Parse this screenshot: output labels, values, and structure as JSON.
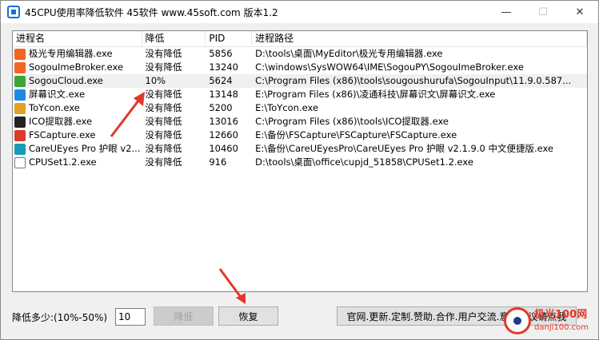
{
  "window": {
    "title": "45CPU使用率降低软件 45软件 www.45soft.com 版本1.2",
    "minimize_glyph": "—",
    "maximize_glyph": "☐",
    "close_glyph": "✕"
  },
  "table": {
    "headers": [
      "进程名",
      "降低",
      "PID",
      "进程路径"
    ],
    "rows": [
      {
        "name": "极光专用编辑器.exe",
        "reduce": "没有降低",
        "pid": "5856",
        "path": "D:\\tools\\桌面\\MyEditor\\极光专用编辑器.exe",
        "icon": "sogou-s-icon",
        "icon_color": "#f26522",
        "selected": false
      },
      {
        "name": "SogouImeBroker.exe",
        "reduce": "没有降低",
        "pid": "13240",
        "path": "C:\\windows\\SysWOW64\\IME\\SogouPY\\SogouImeBroker.exe",
        "icon": "sogou-s-icon",
        "icon_color": "#f26522",
        "selected": false
      },
      {
        "name": "SogouCloud.exe",
        "reduce": "10%",
        "pid": "5624",
        "path": "C:\\Program Files (x86)\\tools\\sougoushurufa\\SogouInput\\11.9.0.587...",
        "icon": "sogou-cloud-icon",
        "icon_color": "#3aa635",
        "selected": true
      },
      {
        "name": "屏幕识文.exe",
        "reduce": "没有降低",
        "pid": "13148",
        "path": "E:\\Program Files (x86)\\凌通科技\\屏幕识文\\屏幕识文.exe",
        "icon": "t-letter-icon",
        "icon_color": "#1e88e5",
        "selected": false
      },
      {
        "name": "ToYcon.exe",
        "reduce": "没有降低",
        "pid": "5200",
        "path": "E:\\ToYcon.exe",
        "icon": "toycon-icon",
        "icon_color": "#e0a020",
        "selected": false
      },
      {
        "name": "ICO提取器.exe",
        "reduce": "没有降低",
        "pid": "13016",
        "path": "C:\\Program Files (x86)\\tools\\ICO提取器.exe",
        "icon": "ico-extractor-icon",
        "icon_color": "#222222",
        "selected": false
      },
      {
        "name": "FSCapture.exe",
        "reduce": "没有降低",
        "pid": "12660",
        "path": "E:\\备份\\FSCapture\\FSCapture\\FSCapture.exe",
        "icon": "fscapture-icon",
        "icon_color": "#d93b2b",
        "selected": false
      },
      {
        "name": "CareUEyes Pro 护眼 v2...",
        "reduce": "没有降低",
        "pid": "10460",
        "path": "E:\\备份\\CareUEyesPro\\CareUEyes Pro 护眼 v2.1.9.0 中文便捷版.exe",
        "icon": "eye-icon",
        "icon_color": "#1a9bb5",
        "selected": false
      },
      {
        "name": "CPUSet1.2.exe",
        "reduce": "没有降低",
        "pid": "916",
        "path": "D:\\tools\\桌面\\office\\cupjd_51858\\CPUSet1.2.exe",
        "icon": "blank-file-icon",
        "icon_color": "#ffffff",
        "selected": false
      }
    ]
  },
  "controls": {
    "reduce_label": "降低多少:(10%-50%)",
    "reduce_value": "10",
    "reduce_button": "降低",
    "restore_button": "恢复",
    "site_button": "官网.更新.定制.赞助.合作.用户交流.意见建议请点我"
  },
  "watermark": {
    "line1": "极光100网",
    "line2": "danji100.com"
  },
  "colors": {
    "annotation_arrow": "#e3372a",
    "selected_row": "#f0f0f0"
  }
}
